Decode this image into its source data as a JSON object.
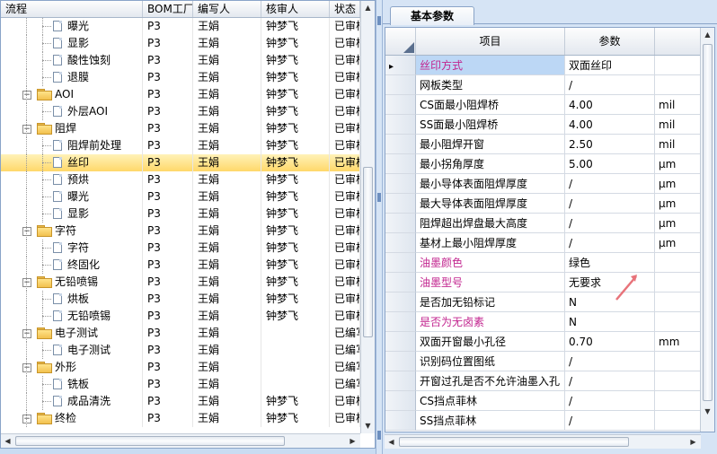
{
  "left": {
    "columns": [
      "流程",
      "BOM工厂",
      "编写人",
      "核审人",
      "状态"
    ],
    "rows": [
      {
        "level": 2,
        "kind": "doc",
        "name": "曝光",
        "bom": "P3",
        "writer": "王娟",
        "reviewer": "钟梦飞",
        "status": "已审核"
      },
      {
        "level": 2,
        "kind": "doc",
        "name": "显影",
        "bom": "P3",
        "writer": "王娟",
        "reviewer": "钟梦飞",
        "status": "已审核"
      },
      {
        "level": 2,
        "kind": "doc",
        "name": "酸性蚀刻",
        "bom": "P3",
        "writer": "王娟",
        "reviewer": "钟梦飞",
        "status": "已审核"
      },
      {
        "level": 2,
        "kind": "doc",
        "name": "退膜",
        "bom": "P3",
        "writer": "王娟",
        "reviewer": "钟梦飞",
        "status": "已审核"
      },
      {
        "level": 1,
        "kind": "folder",
        "name": "AOI",
        "bom": "P3",
        "writer": "王娟",
        "reviewer": "钟梦飞",
        "status": "已审核"
      },
      {
        "level": 2,
        "kind": "doc",
        "name": "外层AOI",
        "bom": "P3",
        "writer": "王娟",
        "reviewer": "钟梦飞",
        "status": "已审核"
      },
      {
        "level": 1,
        "kind": "folder",
        "name": "阻焊",
        "bom": "P3",
        "writer": "王娟",
        "reviewer": "钟梦飞",
        "status": "已审核"
      },
      {
        "level": 2,
        "kind": "doc",
        "name": "阻焊前处理",
        "bom": "P3",
        "writer": "王娟",
        "reviewer": "钟梦飞",
        "status": "已审核"
      },
      {
        "level": 2,
        "kind": "doc",
        "name": "丝印",
        "bom": "P3",
        "writer": "王娟",
        "reviewer": "钟梦飞",
        "status": "已审核",
        "selected": true
      },
      {
        "level": 2,
        "kind": "doc",
        "name": "预烘",
        "bom": "P3",
        "writer": "王娟",
        "reviewer": "钟梦飞",
        "status": "已审核"
      },
      {
        "level": 2,
        "kind": "doc",
        "name": "曝光",
        "bom": "P3",
        "writer": "王娟",
        "reviewer": "钟梦飞",
        "status": "已审核"
      },
      {
        "level": 2,
        "kind": "doc",
        "name": "显影",
        "bom": "P3",
        "writer": "王娟",
        "reviewer": "钟梦飞",
        "status": "已审核"
      },
      {
        "level": 1,
        "kind": "folder",
        "name": "字符",
        "bom": "P3",
        "writer": "王娟",
        "reviewer": "钟梦飞",
        "status": "已审核"
      },
      {
        "level": 2,
        "kind": "doc",
        "name": "字符",
        "bom": "P3",
        "writer": "王娟",
        "reviewer": "钟梦飞",
        "status": "已审核"
      },
      {
        "level": 2,
        "kind": "doc",
        "name": "终固化",
        "bom": "P3",
        "writer": "王娟",
        "reviewer": "钟梦飞",
        "status": "已审核"
      },
      {
        "level": 1,
        "kind": "folder",
        "name": "无铅喷锡",
        "bom": "P3",
        "writer": "王娟",
        "reviewer": "钟梦飞",
        "status": "已审核"
      },
      {
        "level": 2,
        "kind": "doc",
        "name": "烘板",
        "bom": "P3",
        "writer": "王娟",
        "reviewer": "钟梦飞",
        "status": "已审核"
      },
      {
        "level": 2,
        "kind": "doc",
        "name": "无铅喷锡",
        "bom": "P3",
        "writer": "王娟",
        "reviewer": "钟梦飞",
        "status": "已审核"
      },
      {
        "level": 1,
        "kind": "folder",
        "name": "电子测试",
        "bom": "P3",
        "writer": "王娟",
        "reviewer": "",
        "status": "已编写"
      },
      {
        "level": 2,
        "kind": "doc",
        "name": "电子测试",
        "bom": "P3",
        "writer": "王娟",
        "reviewer": "",
        "status": "已编写"
      },
      {
        "level": 1,
        "kind": "folder",
        "name": "外形",
        "bom": "P3",
        "writer": "王娟",
        "reviewer": "",
        "status": "已编写"
      },
      {
        "level": 2,
        "kind": "doc",
        "name": "铣板",
        "bom": "P3",
        "writer": "王娟",
        "reviewer": "",
        "status": "已编写"
      },
      {
        "level": 2,
        "kind": "doc",
        "name": "成品清洗",
        "bom": "P3",
        "writer": "王娟",
        "reviewer": "钟梦飞",
        "status": "已审核"
      },
      {
        "level": 1,
        "kind": "folder",
        "name": "终检",
        "bom": "P3",
        "writer": "王娟",
        "reviewer": "钟梦飞",
        "status": "已审核"
      }
    ]
  },
  "right": {
    "tab_label": "基本参数",
    "columns": [
      "项目",
      "参数"
    ],
    "rows": [
      {
        "item": "丝印方式",
        "value": "双面丝印",
        "unit": "",
        "pink": true,
        "current": true
      },
      {
        "item": "网板类型",
        "value": "/",
        "unit": ""
      },
      {
        "item": "CS面最小阻焊桥",
        "value": "4.00",
        "unit": "mil"
      },
      {
        "item": "SS面最小阻焊桥",
        "value": "4.00",
        "unit": "mil"
      },
      {
        "item": "最小阻焊开窗",
        "value": "2.50",
        "unit": "mil"
      },
      {
        "item": "最小拐角厚度",
        "value": "5.00",
        "unit": "μm"
      },
      {
        "item": "最小导体表面阻焊厚度",
        "value": "/",
        "unit": "μm"
      },
      {
        "item": "最大导体表面阻焊厚度",
        "value": "/",
        "unit": "μm"
      },
      {
        "item": "阻焊超出焊盘最大高度",
        "value": "/",
        "unit": "μm"
      },
      {
        "item": "基材上最小阻焊厚度",
        "value": "/",
        "unit": "μm"
      },
      {
        "item": "油墨颜色",
        "value": "绿色",
        "unit": "",
        "pink": true
      },
      {
        "item": "油墨型号",
        "value": "无要求",
        "unit": "",
        "pink": true
      },
      {
        "item": "是否加无铅标记",
        "value": "N",
        "unit": ""
      },
      {
        "item": "是否为无卤素",
        "value": "N",
        "unit": "",
        "pink": true
      },
      {
        "item": "双面开窗最小孔径",
        "value": "0.70",
        "unit": "mm"
      },
      {
        "item": "识别码位置图纸",
        "value": "/",
        "unit": ""
      },
      {
        "item": "开窗过孔是否不允许油墨入孔",
        "value": "/",
        "unit": ""
      },
      {
        "item": "CS挡点菲林",
        "value": "/",
        "unit": ""
      },
      {
        "item": "SS挡点菲林",
        "value": "/",
        "unit": ""
      }
    ]
  },
  "colors": {
    "pink_text": "#c2258f",
    "selected_row": "#ffd86a",
    "arrow": "#e8737a"
  }
}
